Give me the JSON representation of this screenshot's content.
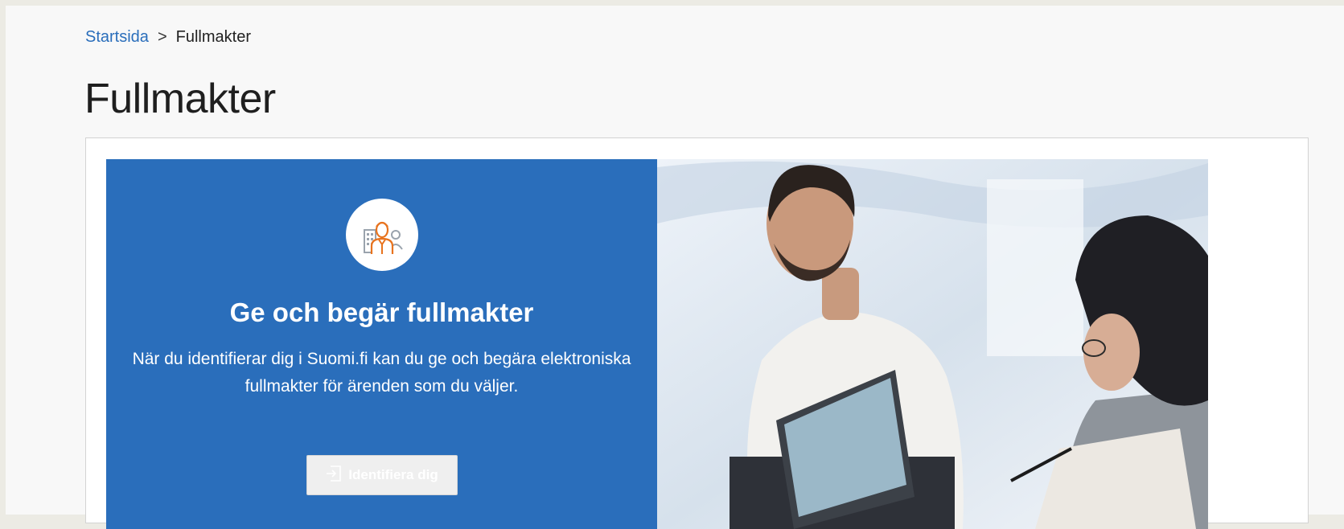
{
  "breadcrumb": {
    "home": "Startsida",
    "separator": ">",
    "current": "Fullmakter"
  },
  "page": {
    "title": "Fullmakter"
  },
  "hero": {
    "icon": "person-with-building-icon",
    "heading": "Ge och begär fullmakter",
    "description": "När du identifierar dig i Suomi.fi kan du ge och begära elektroniska fullmakter för ärenden som du väljer.",
    "button_label": "Identifiera dig",
    "button_icon": "sign-in-icon",
    "accent_color": "#2a6ebb"
  }
}
